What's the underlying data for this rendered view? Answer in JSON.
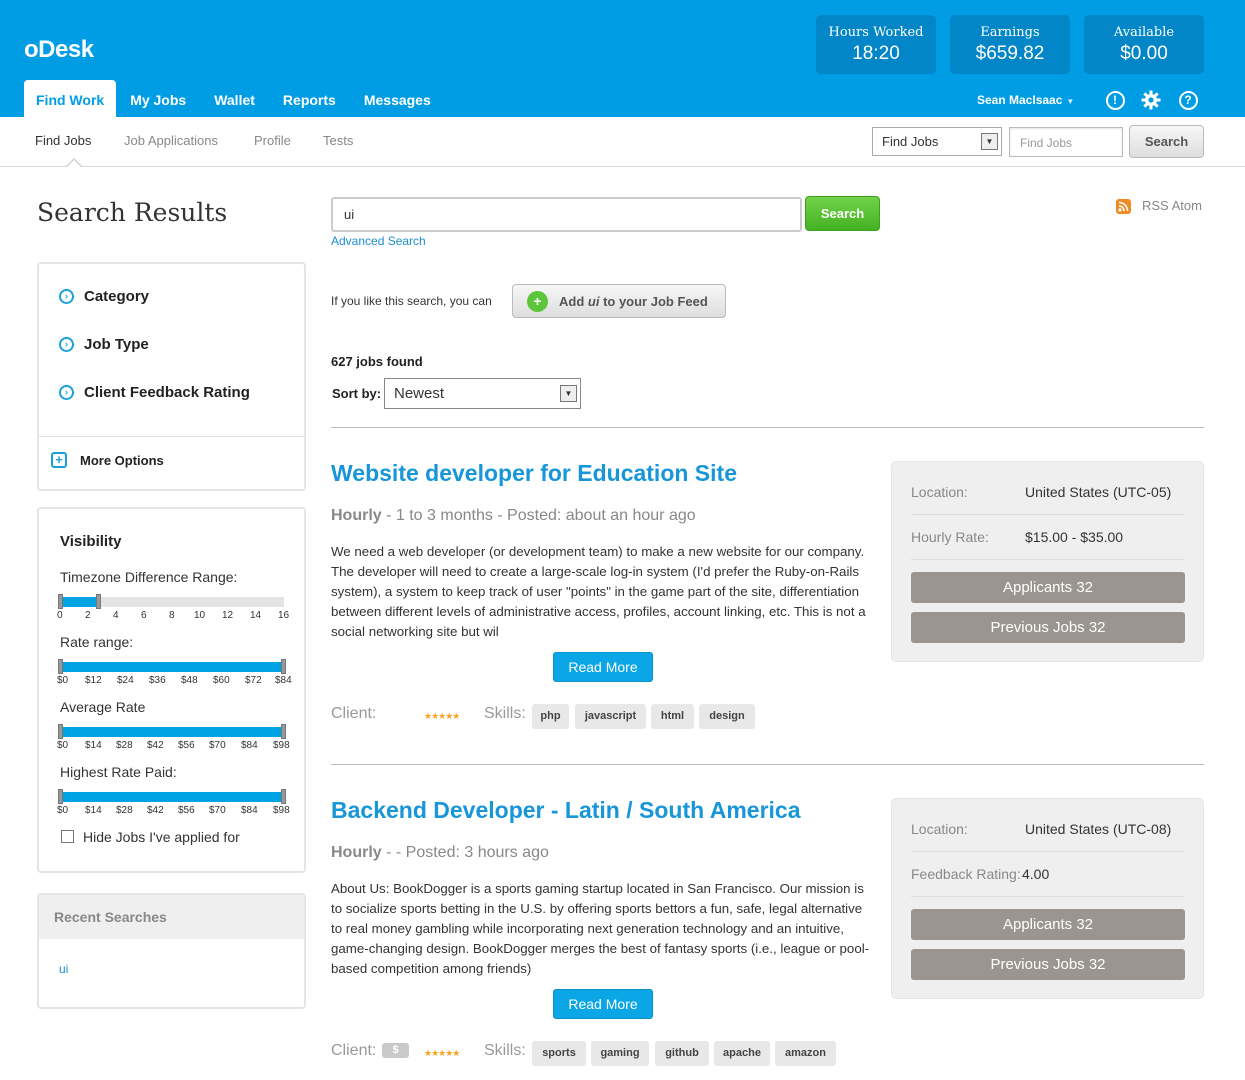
{
  "brand": {
    "logo": "oDesk"
  },
  "stats": [
    {
      "label": "Hours Worked",
      "value": "18:20"
    },
    {
      "label": "Earnings",
      "value": "$659.82"
    },
    {
      "label": "Available",
      "value": "$0.00"
    }
  ],
  "main_nav": [
    "Find Work",
    "My Jobs",
    "Wallet",
    "Reports",
    "Messages"
  ],
  "user": {
    "name": "Sean MacIsaac"
  },
  "sub_nav": [
    "Find Jobs",
    "Job Applications",
    "Profile",
    "Tests"
  ],
  "top_search": {
    "select_value": "Find Jobs",
    "placeholder": "Find Jobs",
    "button": "Search"
  },
  "page_title": "Search Results",
  "search": {
    "value": "ui",
    "button": "Search",
    "advanced": "Advanced Search",
    "rss": "RSS Atom"
  },
  "feed": {
    "prompt": "If you like this search, you can",
    "button_pre": "Add ",
    "button_term": "ui",
    "button_post": " to your Job Feed"
  },
  "results": {
    "count_text": "627 jobs found",
    "sort_label": "Sort by:",
    "sort_value": "Newest"
  },
  "filters": {
    "items": [
      "Category",
      "Job Type",
      "Client Feedback Rating"
    ],
    "more": "More Options"
  },
  "visibility": {
    "title": "Visibility",
    "timezone": {
      "label": "Timezone Difference Range:",
      "ticks": [
        "0",
        "2",
        "4",
        "6",
        "8",
        "10",
        "12",
        "14",
        "16"
      ],
      "range": [
        0,
        2
      ]
    },
    "rate": {
      "label": "Rate range:",
      "ticks": [
        "$0",
        "$12",
        "$24",
        "$36",
        "$48",
        "$60",
        "$72",
        "$84"
      ]
    },
    "average": {
      "label": "Average Rate",
      "ticks": [
        "$0",
        "$14",
        "$28",
        "$42",
        "$56",
        "$70",
        "$84",
        "$98"
      ]
    },
    "highest": {
      "label": "Highest Rate Paid:",
      "ticks": [
        "$0",
        "$14",
        "$28",
        "$42",
        "$56",
        "$70",
        "$84",
        "$98"
      ]
    },
    "hide_applied": "Hide Jobs I've applied for"
  },
  "recent": {
    "title": "Recent Searches",
    "items": [
      "ui"
    ]
  },
  "jobs": [
    {
      "title": "Website developer for Education Site",
      "type": "Hourly",
      "meta": " - 1 to 3 months - Posted: about an hour ago",
      "description": "We need a web developer (or development team) to make a new website for our company. The developer will need to create a large-scale log-in system (I'd prefer the Ruby-on-Rails system), a system to keep track of user \"points\" in the game part of the site, differentiation between different levels of administrative access, profiles, account linking, etc. This is not a social networking site but wil",
      "read_more": "Read More",
      "client_label": "Client:",
      "stars": "★★★★★",
      "skills_label": "Skills:",
      "skills": [
        "php",
        "javascript",
        "html",
        "design"
      ],
      "info": [
        {
          "label": "Location:",
          "value": "United States (UTC-05)"
        },
        {
          "label": "Hourly Rate:",
          "value": "$15.00 - $35.00"
        }
      ],
      "applicants": "Applicants 32",
      "previous": "Previous Jobs 32"
    },
    {
      "title": "Backend Developer - Latin / South America",
      "type": "Hourly",
      "meta": " - - Posted: 3 hours ago",
      "description": "About Us: BookDogger is a sports gaming startup located in San Francisco.  Our mission is to socialize sports betting in the U.S. by offering sports bettors a fun, safe, legal alternative to real money gambling while incorporating next generation technology and an intuitive, game-changing design.  BookDogger merges the best of fantasy sports (i.e., league or pool-based competition among friends)",
      "read_more": "Read More",
      "client_label": "Client:",
      "client_badge": "$",
      "stars": "★★★★★",
      "skills_label": "Skills:",
      "skills": [
        "sports",
        "gaming",
        "github",
        "apache",
        "amazon"
      ],
      "info": [
        {
          "label": "Location:",
          "value": "United States (UTC-08)"
        },
        {
          "label": "Feedback Rating:",
          "value": "4.00"
        }
      ],
      "applicants": "Applicants 32",
      "previous": "Previous Jobs 32"
    }
  ]
}
